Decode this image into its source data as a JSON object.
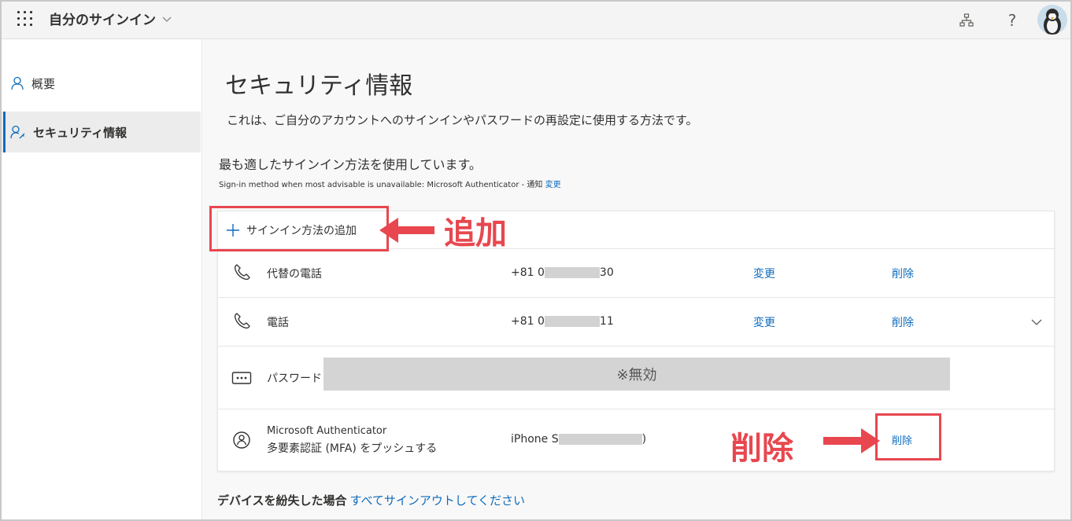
{
  "topbar": {
    "app_title": "自分のサインイン",
    "icons": [
      "waffle-icon",
      "org-chart-icon",
      "help-icon",
      "avatar"
    ],
    "help_label": "?"
  },
  "sidebar": {
    "items": [
      {
        "label": "概要",
        "icon": "person-icon",
        "active": false
      },
      {
        "label": "セキュリティ情報",
        "icon": "person-key-icon",
        "active": true
      }
    ]
  },
  "main": {
    "title": "セキュリティ情報",
    "description": "これは、ご自分のアカウントへのサインインやパスワードの再設定に使用する方法です。",
    "best_method": "最も適したサインイン方法を使用しています。",
    "fallback_text": "Sign-in method when most advisable is unavailable: Microsoft Authenticator - 通知",
    "fallback_change": "変更",
    "add_method": "サインイン方法の追加",
    "methods": [
      {
        "icon": "phone-icon",
        "label": "代替の電話",
        "value_start": "+81 0",
        "value_end": "30",
        "change": "変更",
        "delete": "削除"
      },
      {
        "icon": "phone-icon",
        "label": "電話",
        "value_start": "+81 0",
        "value_end": "11",
        "change": "変更",
        "delete": "削除"
      },
      {
        "icon": "password-icon",
        "label": "パスワード",
        "disabled_note": "※無効"
      },
      {
        "icon": "authenticator-icon",
        "label_line1": "Microsoft Authenticator",
        "label_line2": "多要素認証 (MFA) をプッシュする",
        "value_start": "iPhone S",
        "value_end": ")",
        "delete": "削除"
      }
    ],
    "lost_device_label": "デバイスを紛失した場合",
    "lost_device_link": "すべてサインアウトしてください"
  },
  "annotations": {
    "add_label": "追加",
    "delete_label": "削除",
    "color": "#e8474f"
  },
  "colors": {
    "link": "#0f6cbd",
    "active_indicator": "#0f6cbd",
    "mask": "#d2d2d2"
  }
}
